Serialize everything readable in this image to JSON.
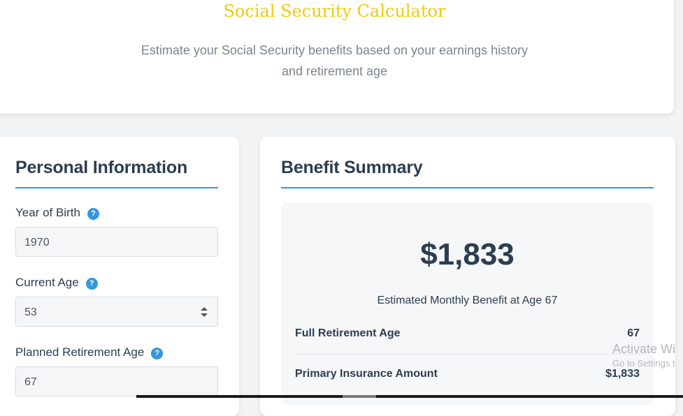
{
  "header": {
    "title": "Social Security Calculator",
    "subtitle_line1": "Estimate your Social Security benefits based on your earnings history",
    "subtitle_line2": "and retirement age"
  },
  "personal_info": {
    "title": "Personal Information",
    "help_glyph": "?",
    "fields": [
      {
        "label": "Year of Birth",
        "value": "1970"
      },
      {
        "label": "Current Age",
        "value": "53"
      },
      {
        "label": "Planned Retirement Age",
        "value": "67"
      }
    ]
  },
  "benefit_summary": {
    "title": "Benefit Summary",
    "amount": "$1,833",
    "caption": "Estimated Monthly Benefit at Age 67",
    "rows": [
      {
        "label": "Full Retirement Age",
        "value": "67"
      },
      {
        "label": "Primary Insurance Amount",
        "value": "$1,833"
      }
    ]
  },
  "watermark": {
    "line1": "Activate Wi",
    "line2": "Go to Settings t"
  },
  "colors": {
    "accent": "#3498db",
    "title_gold": "#f2c811",
    "text_dark": "#2c3e50",
    "muted": "#7b8590"
  }
}
